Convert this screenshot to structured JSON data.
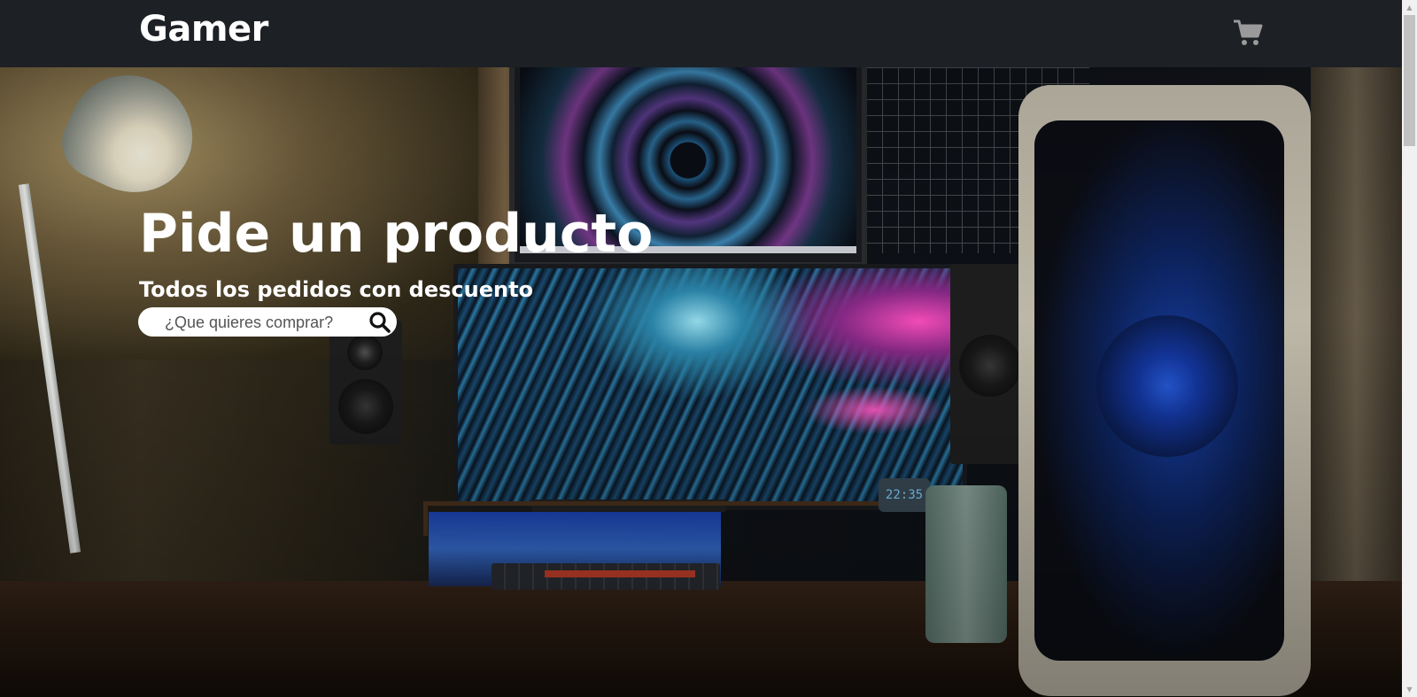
{
  "header": {
    "brand": "Gamer",
    "cart_icon": "shopping-cart-icon"
  },
  "hero": {
    "title": "Pide un producto",
    "subtitle": "Todos los pedidos con descuento",
    "search": {
      "placeholder": "¿Que quieres comprar?",
      "value": "",
      "icon": "search-icon"
    },
    "background_image": "gaming-desk-setup-photo"
  },
  "colors": {
    "header_bg": "#1d2024",
    "text": "#ffffff",
    "cart_icon": "#9a9a9a"
  }
}
